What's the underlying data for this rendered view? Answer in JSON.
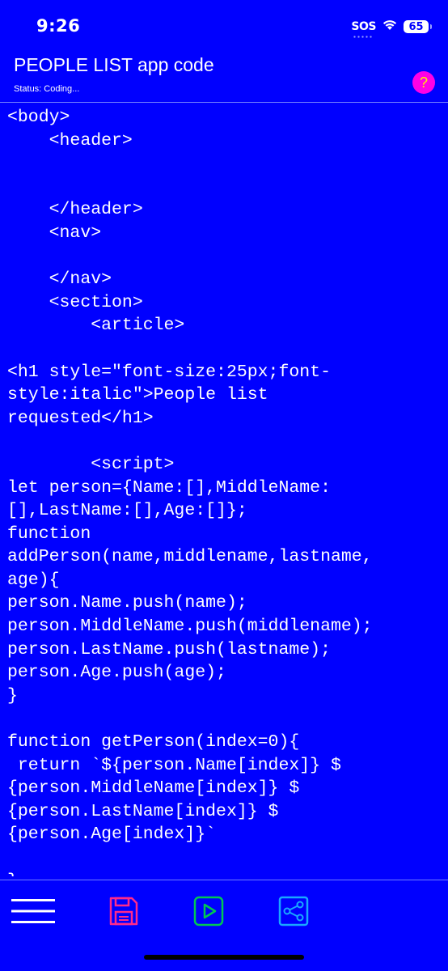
{
  "status_bar": {
    "time": "9:26",
    "sos": "SOS",
    "battery": "65"
  },
  "header": {
    "title": "PEOPLE LIST app code",
    "status": "Status: Coding...",
    "help_label": "?"
  },
  "editor": {
    "code": "<body>\n    <header>\n\n\n    </header>\n    <nav>\n\n    </nav>\n    <section>\n        <article>\n\n<h1 style=\"font-size:25px;font-\nstyle:italic\">People list\nrequested</h1>\n\n        <script>\nlet person={Name:[],MiddleName:\n[],LastName:[],Age:[]};\nfunction\naddPerson(name,middlename,lastname,\nage){\nperson.Name.push(name);\nperson.MiddleName.push(middlename);\nperson.LastName.push(lastname);\nperson.Age.push(age);\n}\n\nfunction getPerson(index=0){\n return `${person.Name[index]} $\n{person.MiddleName[index]} $\n{person.LastName[index]} $\n{person.Age[index]}`\n\n}"
  },
  "toolbar": {
    "icons": [
      "menu-icon",
      "save-icon",
      "run-icon",
      "share-icon"
    ]
  },
  "colors": {
    "background": "#0000ff",
    "text": "#ffffff",
    "help_button": "#ff00e6",
    "save_icon": "#ff2a8a",
    "run_icon": "#00c853",
    "share_icon": "#19a8ff"
  }
}
